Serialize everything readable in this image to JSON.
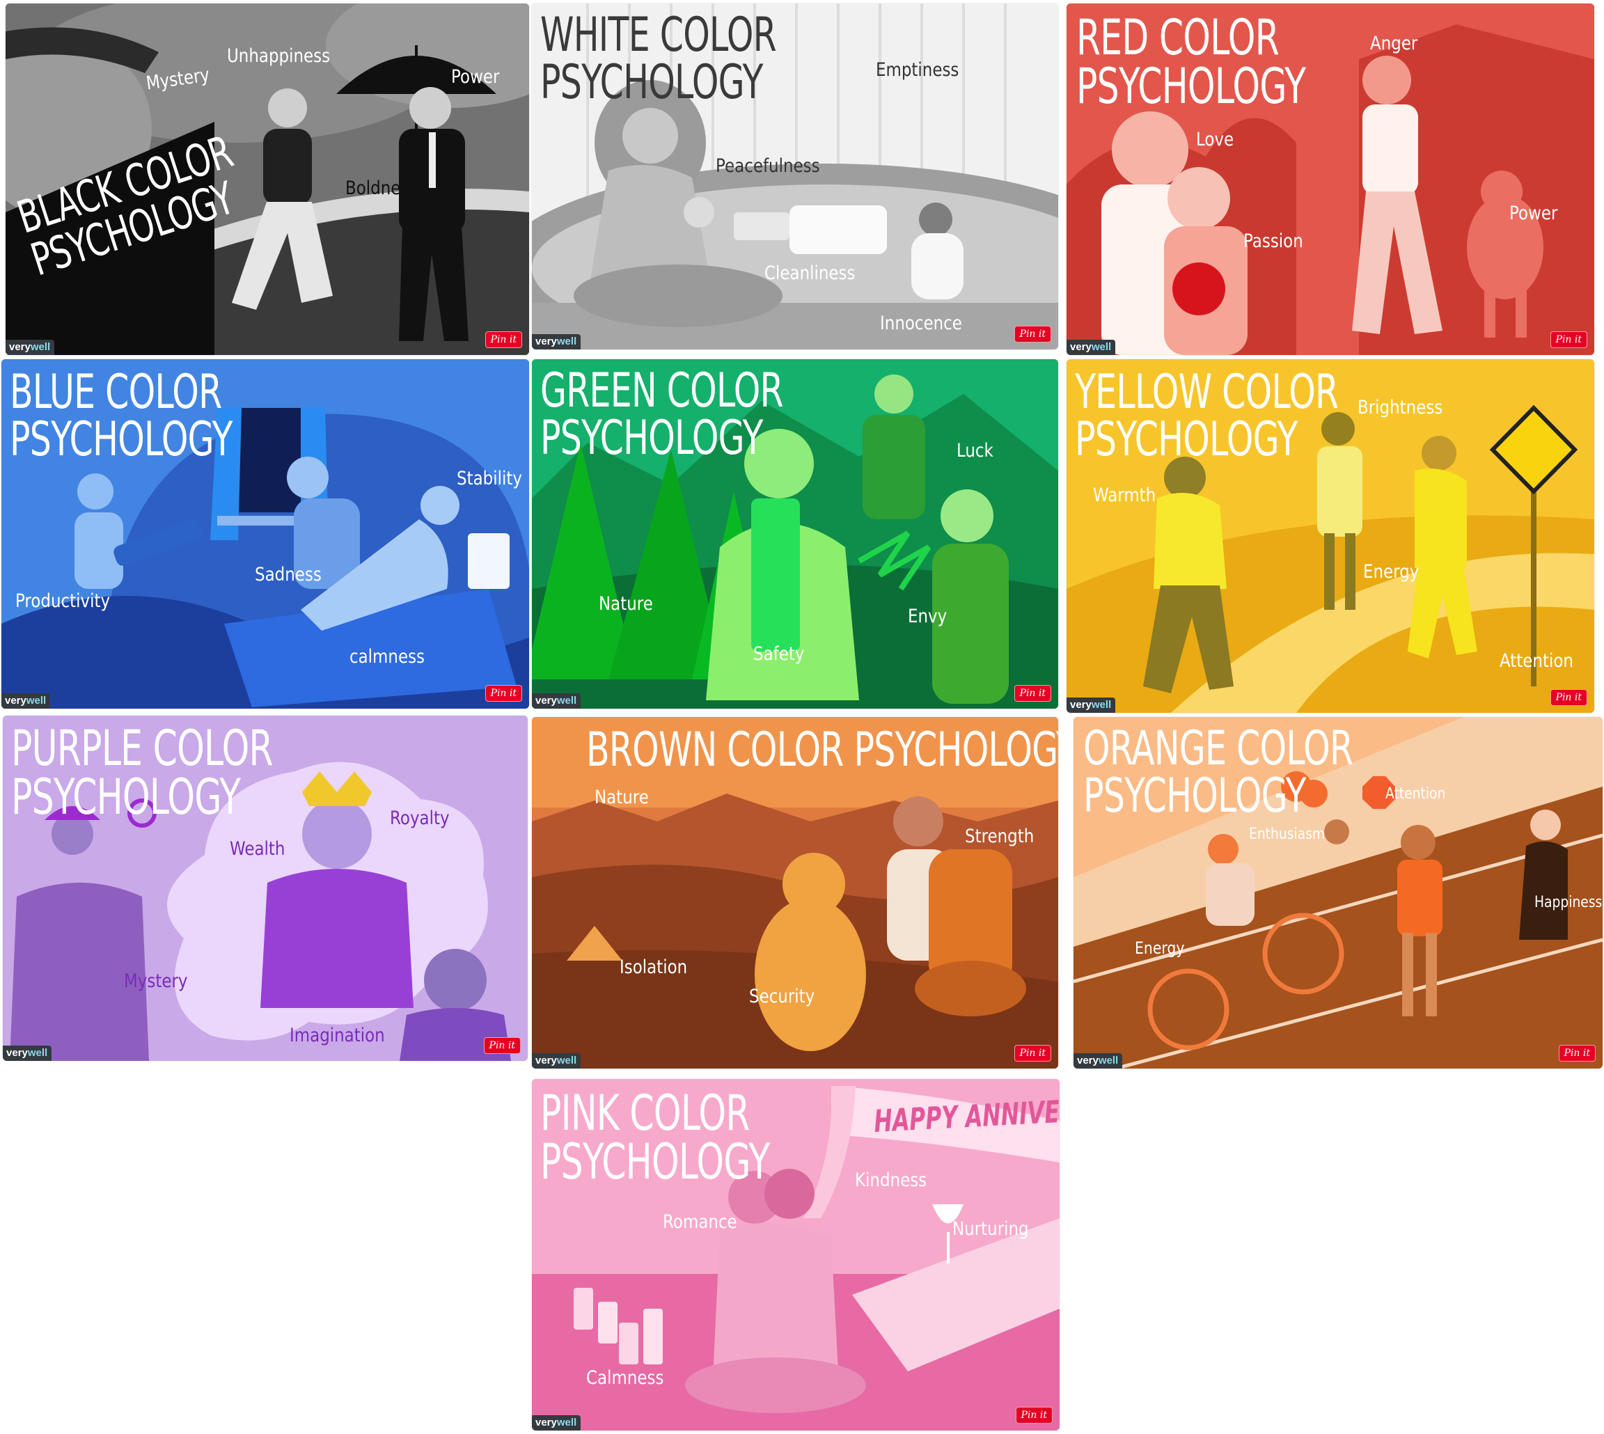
{
  "cards": [
    {
      "title_lines": [
        "BLACK COLOR",
        "PSYCHOLOGY"
      ],
      "words": [
        "Mystery",
        "Unhappiness",
        "Power",
        "Boldness"
      ],
      "logo": {
        "a": "very",
        "b": "well"
      },
      "pin_label": "Pin it",
      "colors": {
        "bg": "#5f5f5f",
        "accent": "#1a1a1a"
      }
    },
    {
      "title_lines": [
        "WHITE COLOR",
        "PSYCHOLOGY"
      ],
      "words": [
        "Emptiness",
        "Peacefulness",
        "Cleanliness",
        "Innocence"
      ],
      "logo": {
        "a": "very",
        "b": "well"
      },
      "pin_label": "Pin it",
      "colors": {
        "bg": "#ebebeb",
        "accent": "#bdbdbd"
      }
    },
    {
      "title_lines": [
        "RED COLOR",
        "PSYCHOLOGY"
      ],
      "words": [
        "Anger",
        "Love",
        "Power",
        "Passion"
      ],
      "logo": {
        "a": "very",
        "b": "well"
      },
      "pin_label": "Pin it",
      "colors": {
        "bg": "#e55a4f",
        "accent": "#c9372f"
      }
    },
    {
      "title_lines": [
        "BLUE COLOR",
        "PSYCHOLOGY"
      ],
      "words": [
        "Stability",
        "Sadness",
        "Productivity",
        "calmness"
      ],
      "logo": {
        "a": "very",
        "b": "well"
      },
      "pin_label": "Pin it",
      "colors": {
        "bg": "#3f7fe0",
        "accent": "#1f4fb8"
      }
    },
    {
      "title_lines": [
        "GREEN COLOR",
        "PSYCHOLOGY"
      ],
      "words": [
        "Luck",
        "Nature",
        "Envy",
        "Safety"
      ],
      "logo": {
        "a": "very",
        "b": "well"
      },
      "pin_label": "Pin it",
      "colors": {
        "bg": "#17a566",
        "accent": "#0d7a3e"
      }
    },
    {
      "title_lines": [
        "YELLOW COLOR",
        "PSYCHOLOGY"
      ],
      "words": [
        "Brightness",
        "Warmth",
        "Energy",
        "Attention"
      ],
      "logo": {
        "a": "very",
        "b": "well"
      },
      "pin_label": "Pin it",
      "colors": {
        "bg": "#f6c22a",
        "accent": "#e8a912"
      }
    },
    {
      "title_lines": [
        "PURPLE COLOR",
        "PSYCHOLOGY"
      ],
      "words": [
        "Royalty",
        "Wealth",
        "Mystery",
        "Imagination"
      ],
      "logo": {
        "a": "very",
        "b": "well"
      },
      "pin_label": "Pin it",
      "colors": {
        "bg": "#c7a8e6",
        "accent": "#8e4fc9"
      }
    },
    {
      "title_lines": [
        "BROWN COLOR PSYCHOLOGY"
      ],
      "words": [
        "Nature",
        "Strength",
        "Isolation",
        "Security"
      ],
      "logo": {
        "a": "very",
        "b": "well"
      },
      "pin_label": "Pin it",
      "colors": {
        "bg": "#a2522b",
        "accent": "#e2903c"
      }
    },
    {
      "title_lines": [
        "ORANGE COLOR",
        "PSYCHOLOGY"
      ],
      "words": [
        "Attention",
        "Enthusiasm",
        "Happiness",
        "Energy"
      ],
      "logo": {
        "a": "very",
        "b": "well"
      },
      "pin_label": "Pin it",
      "colors": {
        "bg": "#b5622a",
        "accent": "#f09a55"
      }
    },
    {
      "title_lines": [
        "PINK COLOR",
        "PSYCHOLOGY"
      ],
      "words": [
        "HAPPY ANNIVER",
        "Kindness",
        "Romance",
        "Nurturing",
        "Calmness"
      ],
      "logo": {
        "a": "very",
        "b": "well"
      },
      "pin_label": "Pin it",
      "colors": {
        "bg": "#f39ac2",
        "accent": "#e2579a"
      }
    }
  ]
}
